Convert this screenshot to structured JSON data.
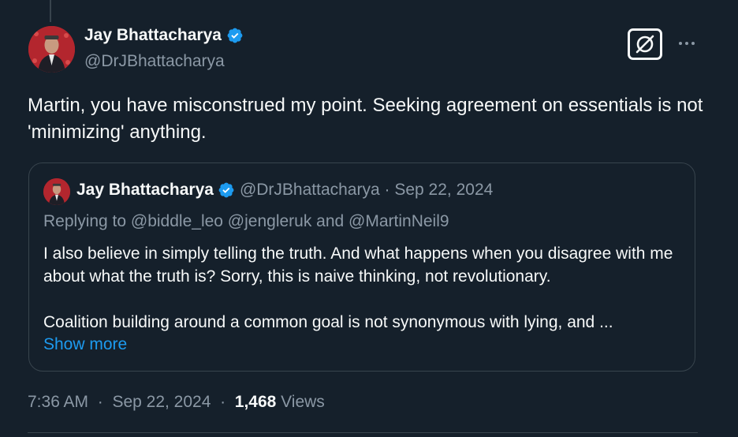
{
  "tweet": {
    "author": {
      "name": "Jay Bhattacharya",
      "handle": "@DrJBhattacharya",
      "verified_icon": "verified-badge-icon",
      "verified_color": "#1d9bf0"
    },
    "text": "Martin, you have misconstrued my point. Seeking agreement on essentials is not 'minimizing' anything.",
    "quoted": {
      "name": "Jay Bhattacharya",
      "handle": "@DrJBhattacharya",
      "separator": "·",
      "date": "Sep 22, 2024",
      "replying_to": "Replying to @biddle_leo @jengleruk and @MartinNeil9",
      "body_line1": "I also believe in simply telling the truth. And what happens when you disagree with me about what the truth is? Sorry, this is naive thinking, not revolutionary.",
      "body_line2": "Coalition building around a common goal is not synonymous with lying, and ...",
      "show_more": "Show more"
    },
    "meta": {
      "time": "7:36 AM",
      "separator": "·",
      "date": "Sep 22, 2024",
      "views_count": "1,468",
      "views_label": "Views"
    }
  },
  "colors": {
    "background": "#15202b",
    "accent": "#1d9bf0",
    "secondary_text": "#8b98a5",
    "border": "#38444d"
  },
  "icons": {
    "grok": "grok-icon",
    "more": "more-horizontal-icon"
  }
}
